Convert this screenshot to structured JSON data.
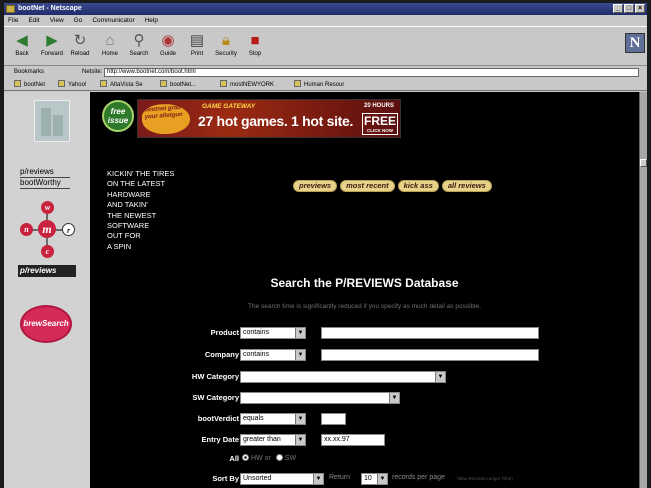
{
  "window": {
    "title": "bootNet - Netscape"
  },
  "menu": [
    "File",
    "Edit",
    "View",
    "Go",
    "Communicator",
    "Help"
  ],
  "toolbar": {
    "buttons": [
      {
        "label": "Back",
        "icon": "back-arrow-icon"
      },
      {
        "label": "Forward",
        "icon": "forward-arrow-icon"
      },
      {
        "label": "Reload",
        "icon": "reload-icon"
      },
      {
        "label": "Home",
        "icon": "home-icon"
      },
      {
        "label": "Search",
        "icon": "search-icon"
      },
      {
        "label": "Guide",
        "icon": "guide-icon"
      },
      {
        "label": "Print",
        "icon": "print-icon"
      },
      {
        "label": "Security",
        "icon": "security-icon"
      },
      {
        "label": "Stop",
        "icon": "stop-icon"
      }
    ],
    "logo": "N"
  },
  "location": {
    "bookmarks_label": "Bookmarks",
    "netsite_label": "Netsite:",
    "url": "http://www.bootnet.com/boot.html"
  },
  "personal_toolbar": [
    "bootNet",
    "Yahoo!",
    "AltaVista Se",
    "bootNet...",
    "mostNEWYORK",
    "Human Resour"
  ],
  "sidebar": {
    "links": [
      "p/reviews",
      "bootWorthy"
    ],
    "wmrc": [
      "w",
      "m",
      "r",
      "c",
      "n"
    ],
    "section_label": "p/reviews",
    "brew_label": "brewSearch"
  },
  "banner": {
    "free_issue": "free issue",
    "gun_text": "bootnet grab your allotgun",
    "gateway": "GAME GATEWAY",
    "tagline": "27 hot games. 1 hot site.",
    "hours": "20 HOURS",
    "free": "FREE",
    "click": "CLICK NOW"
  },
  "intro_lines": [
    "KICKIN' THE TIRES",
    "ON THE LATEST",
    "HARDWARE",
    "AND TAKIN'",
    "THE NEWEST",
    "SOFTWARE",
    "OUT FOR",
    "A SPIN"
  ],
  "nav_pills": [
    "previews",
    "most recent",
    "kick ass",
    "all reviews"
  ],
  "search": {
    "title": "Search the P/REVIEWS Database",
    "subtitle": "The search time is significantly reduced if you specify as much detail as possible.",
    "product": {
      "label": "Product",
      "op": "contains",
      "value": ""
    },
    "company": {
      "label": "Company",
      "op": "contains",
      "value": ""
    },
    "hw_category": {
      "label": "HW Category",
      "value": ""
    },
    "sw_category": {
      "label": "SW Category",
      "value": ""
    },
    "bootverdict": {
      "label": "bootVerdict",
      "op": "equals",
      "value": ""
    },
    "entry_date": {
      "label": "Entry Date",
      "op": "greater than",
      "value": "xx.xx.97"
    },
    "all": {
      "label": "All",
      "hw": "HW or",
      "sw": "SW"
    },
    "sort": {
      "label": "Sort By",
      "value": "Unsorted",
      "return_label": "Return",
      "return_value": "10",
      "per_page": "records per page",
      "note": "(Max Records Longer Time)"
    }
  }
}
